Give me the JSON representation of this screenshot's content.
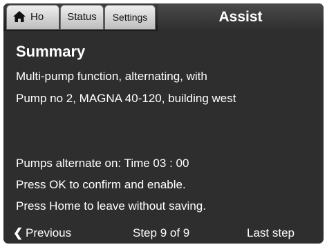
{
  "tabs": {
    "home_label": "Ho",
    "status_label": "Status",
    "settings_label": "Settings",
    "active_label": "Assist"
  },
  "content": {
    "title": "Summary",
    "lines": [
      "Multi-pump function, alternating, with",
      "Pump no 2, MAGNA 40-120, building west",
      "Pumps alternate on: Time 03 : 00",
      "Press OK to confirm and enable.",
      "Press Home to leave without saving."
    ]
  },
  "footer": {
    "previous_label": "Previous",
    "step_label": "Step 9 of 9",
    "last_label": "Last step"
  },
  "colors": {
    "background": "#2e2e2e",
    "text": "#ffffff",
    "tab_inactive": "#d9d9d9"
  },
  "icons": {
    "home": "home-icon",
    "previous": "chevron-left-icon"
  }
}
